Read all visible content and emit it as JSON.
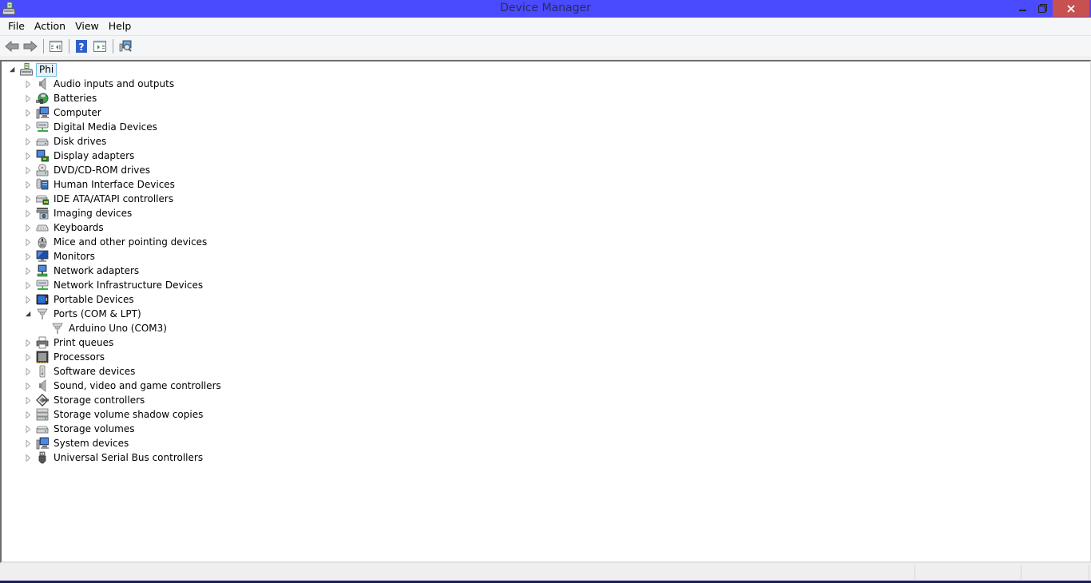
{
  "window": {
    "title": "Device Manager",
    "accent_color": "#4a4aff",
    "close_color": "#c75050"
  },
  "menu": {
    "items": [
      {
        "label": "File"
      },
      {
        "label": "Action"
      },
      {
        "label": "View"
      },
      {
        "label": "Help"
      }
    ]
  },
  "toolbar": {
    "buttons": [
      {
        "name": "back",
        "icon": "arrow-left-icon"
      },
      {
        "name": "forward",
        "icon": "arrow-right-icon"
      },
      {
        "name": "show-hide-console-tree",
        "icon": "console-tree-icon"
      },
      {
        "name": "help",
        "icon": "help-icon"
      },
      {
        "name": "show-hide-action-pane",
        "icon": "action-pane-icon"
      },
      {
        "name": "scan-hardware-changes",
        "icon": "scan-hardware-icon"
      }
    ]
  },
  "tree": {
    "root": {
      "label": "Phi",
      "expanded": true,
      "icon": "computer-root-icon"
    },
    "categories": [
      {
        "label": "Audio inputs and outputs",
        "icon": "speaker-icon",
        "expanded": false
      },
      {
        "label": "Batteries",
        "icon": "battery-icon",
        "expanded": false
      },
      {
        "label": "Computer",
        "icon": "computer-icon",
        "expanded": false
      },
      {
        "label": "Digital Media Devices",
        "icon": "media-device-icon",
        "expanded": false
      },
      {
        "label": "Disk drives",
        "icon": "disk-drive-icon",
        "expanded": false
      },
      {
        "label": "Display adapters",
        "icon": "display-adapter-icon",
        "expanded": false
      },
      {
        "label": "DVD/CD-ROM drives",
        "icon": "dvd-drive-icon",
        "expanded": false
      },
      {
        "label": "Human Interface Devices",
        "icon": "hid-icon",
        "expanded": false
      },
      {
        "label": "IDE ATA/ATAPI controllers",
        "icon": "ide-controller-icon",
        "expanded": false
      },
      {
        "label": "Imaging devices",
        "icon": "camera-icon",
        "expanded": false
      },
      {
        "label": "Keyboards",
        "icon": "keyboard-icon",
        "expanded": false
      },
      {
        "label": "Mice and other pointing devices",
        "icon": "mouse-icon",
        "expanded": false
      },
      {
        "label": "Monitors",
        "icon": "monitor-icon",
        "expanded": false
      },
      {
        "label": "Network adapters",
        "icon": "network-adapter-icon",
        "expanded": false
      },
      {
        "label": "Network Infrastructure Devices",
        "icon": "network-infrastructure-icon",
        "expanded": false
      },
      {
        "label": "Portable Devices",
        "icon": "portable-device-icon",
        "expanded": false
      },
      {
        "label": "Ports (COM & LPT)",
        "icon": "port-icon",
        "expanded": true,
        "children": [
          {
            "label": "Arduino Uno (COM3)",
            "icon": "port-icon"
          }
        ]
      },
      {
        "label": "Print queues",
        "icon": "printer-icon",
        "expanded": false
      },
      {
        "label": "Processors",
        "icon": "processor-icon",
        "expanded": false
      },
      {
        "label": "Software devices",
        "icon": "software-device-icon",
        "expanded": false
      },
      {
        "label": "Sound, video and game controllers",
        "icon": "speaker-icon",
        "expanded": false
      },
      {
        "label": "Storage controllers",
        "icon": "storage-controller-icon",
        "expanded": false
      },
      {
        "label": "Storage volume shadow copies",
        "icon": "shadow-copy-icon",
        "expanded": false
      },
      {
        "label": "Storage volumes",
        "icon": "disk-drive-icon",
        "expanded": false
      },
      {
        "label": "System devices",
        "icon": "computer-icon",
        "expanded": false
      },
      {
        "label": "Universal Serial Bus controllers",
        "icon": "usb-icon",
        "expanded": false
      }
    ]
  },
  "statusbar": {
    "panels": [
      "",
      "",
      ""
    ]
  }
}
